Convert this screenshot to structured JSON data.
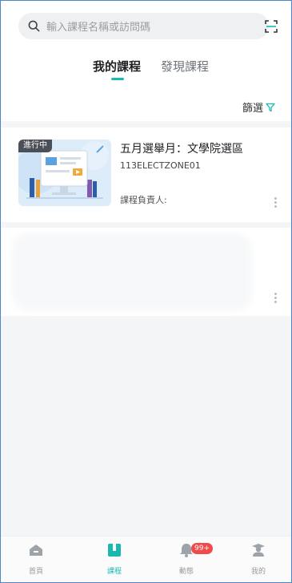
{
  "search": {
    "placeholder": "輸入課程名稱或訪問碼"
  },
  "tabs": [
    {
      "label": "我的課程",
      "active": true
    },
    {
      "label": "發現課程",
      "active": false
    }
  ],
  "filter": {
    "label": "篩選"
  },
  "courses": [
    {
      "status": "進行中",
      "title": "五月選舉月：文學院選區",
      "code": "113ELECTZONE01",
      "owner_label": "課程負責人:"
    }
  ],
  "bottom_nav": [
    {
      "label": "首頁",
      "icon": "home-icon",
      "active": false
    },
    {
      "label": "課程",
      "icon": "book-icon",
      "active": true
    },
    {
      "label": "動態",
      "icon": "bell-icon",
      "active": false,
      "badge": "99+"
    },
    {
      "label": "我的",
      "icon": "profile-icon",
      "active": false
    }
  ],
  "colors": {
    "accent": "#1bb8b1",
    "badge": "#f04a4a"
  }
}
